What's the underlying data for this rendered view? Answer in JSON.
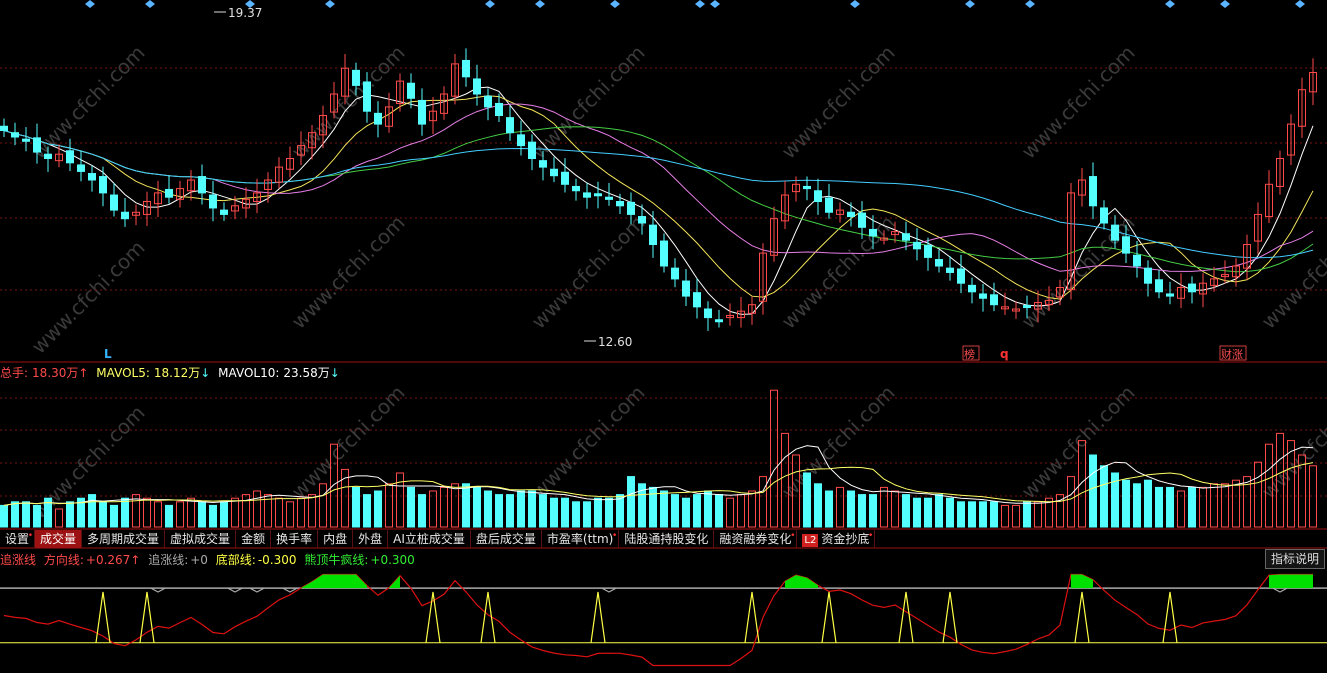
{
  "price_panel": {
    "high_label": "19.37",
    "low_label": "12.60",
    "markers": [
      {
        "text": "L",
        "color": "#35b4ff"
      },
      {
        "text": "榜",
        "color": "#ff4d4d",
        "boxed": true
      },
      {
        "text": "q",
        "color": "#ff3333"
      },
      {
        "text": "财涨",
        "color": "#ff4d4d",
        "boxed": true
      }
    ]
  },
  "volume_legend": {
    "total_label": "总手:",
    "total_value": "18.30万",
    "total_arrow": "↑",
    "mavol5_label": "MAVOL5:",
    "mavol5_value": "18.12万",
    "mavol5_arrow": "↓",
    "mavol10_label": "MAVOL10:",
    "mavol10_value": "23.58万",
    "mavol10_arrow": "↓"
  },
  "tabs": [
    {
      "label": "设置",
      "dot": true
    },
    {
      "label": "成交量",
      "active": true
    },
    {
      "label": "多周期成交量"
    },
    {
      "label": "虚拟成交量"
    },
    {
      "label": "金额"
    },
    {
      "label": "换手率"
    },
    {
      "label": "内盘"
    },
    {
      "label": "外盘"
    },
    {
      "label": "AI立桩成交量"
    },
    {
      "label": "盘后成交量"
    },
    {
      "label": "市盈率(ttm)",
      "dot": true
    },
    {
      "label": "陆股通持股变化"
    },
    {
      "label": "融资融券变化",
      "dot": true
    },
    {
      "label": "资金抄底",
      "badge": "L2",
      "dot": true
    }
  ],
  "help_button": "指标说明",
  "indicator_legend": {
    "name1": "追涨线",
    "dir_label": "方向线:",
    "dir_value": "+0.267",
    "dir_arrow": "↑",
    "chase_label": "追涨线:",
    "chase_value": "+0",
    "bottom_label": "底部线:",
    "bottom_value": "-0.300",
    "bearbull_label": "熊顶牛疯线:",
    "bearbull_value": "+0.300"
  },
  "watermark": "www.cfchi.com",
  "colors": {
    "up": "#ff4a4a",
    "down": "#54ffff",
    "ma5": "#ffffff",
    "ma10": "#f5e55a",
    "ma20": "#e67ee6",
    "ma30": "#44cc44",
    "ma60": "#44ccff",
    "grid": "#7a1414",
    "dir_line": "#dd1111",
    "spike_yellow": "#ffff44",
    "spike_gray": "#aaaaaa",
    "fill_green": "#00e000"
  },
  "chart_data": {
    "type": "candlestick",
    "price_high": 19.37,
    "price_low": 12.6,
    "ylim": [
      11.9,
      19.9
    ],
    "bars": 120,
    "closes": [
      17.05,
      16.9,
      16.8,
      16.55,
      16.4,
      16.5,
      16.3,
      16.1,
      15.9,
      15.6,
      15.2,
      15.0,
      15.15,
      15.4,
      15.6,
      15.5,
      15.7,
      15.9,
      15.6,
      15.25,
      15.1,
      15.3,
      15.45,
      15.6,
      15.9,
      16.2,
      16.4,
      16.7,
      17.0,
      17.4,
      17.9,
      18.5,
      18.1,
      17.5,
      17.2,
      17.6,
      18.2,
      17.8,
      17.2,
      17.5,
      17.9,
      18.6,
      18.3,
      17.9,
      17.6,
      17.4,
      17.0,
      16.7,
      16.4,
      16.2,
      16.0,
      15.8,
      15.65,
      15.5,
      15.55,
      15.45,
      15.3,
      15.1,
      14.9,
      14.4,
      13.9,
      13.6,
      13.2,
      12.95,
      12.7,
      12.62,
      12.75,
      12.85,
      13.0,
      14.2,
      15.0,
      15.55,
      15.8,
      15.7,
      15.4,
      15.15,
      15.2,
      15.05,
      14.8,
      14.6,
      14.55,
      14.7,
      14.5,
      14.3,
      14.1,
      13.9,
      13.75,
      13.5,
      13.3,
      13.15,
      13.0,
      12.95,
      12.9,
      12.95,
      13.05,
      13.1,
      13.4,
      15.6,
      15.9,
      15.3,
      14.9,
      14.5,
      14.2,
      13.9,
      13.5,
      13.3,
      13.2,
      13.4,
      13.3,
      13.5,
      13.6,
      13.7,
      13.9,
      14.4,
      15.1,
      15.8,
      16.4,
      17.2,
      18.0,
      18.4
    ],
    "volume_ylim": [
      0,
      40
    ],
    "volumes": [
      6,
      7,
      7,
      6,
      8,
      5,
      7,
      8,
      9,
      7,
      6,
      8,
      9,
      8,
      7,
      6,
      7,
      8,
      7,
      6,
      7,
      8,
      9,
      10,
      9,
      8,
      7,
      8,
      9,
      12,
      23,
      16,
      11,
      9,
      10,
      12,
      15,
      11,
      9,
      10,
      11,
      12,
      12,
      11,
      10,
      9,
      9,
      10,
      10,
      9,
      8,
      8,
      7,
      7,
      8,
      8,
      9,
      14,
      12,
      11,
      10,
      9,
      8,
      9,
      10,
      9,
      8,
      9,
      10,
      14,
      38,
      26,
      20,
      15,
      12,
      10,
      11,
      10,
      9,
      9,
      11,
      10,
      9,
      8,
      8,
      9,
      8,
      7,
      7,
      7,
      7,
      6,
      6,
      7,
      7,
      8,
      9,
      14,
      24,
      20,
      17,
      15,
      13,
      12,
      13,
      11,
      11,
      10,
      11,
      11,
      12,
      12,
      13,
      14,
      18,
      23,
      26,
      24,
      20,
      17
    ],
    "mavol5_series": "computed 5-period moving average of volumes",
    "indicator_ylim": [
      -0.6,
      0.5
    ],
    "bottom_line": -0.3,
    "bearbull_line": 0.3,
    "direction_last": 0.267
  }
}
